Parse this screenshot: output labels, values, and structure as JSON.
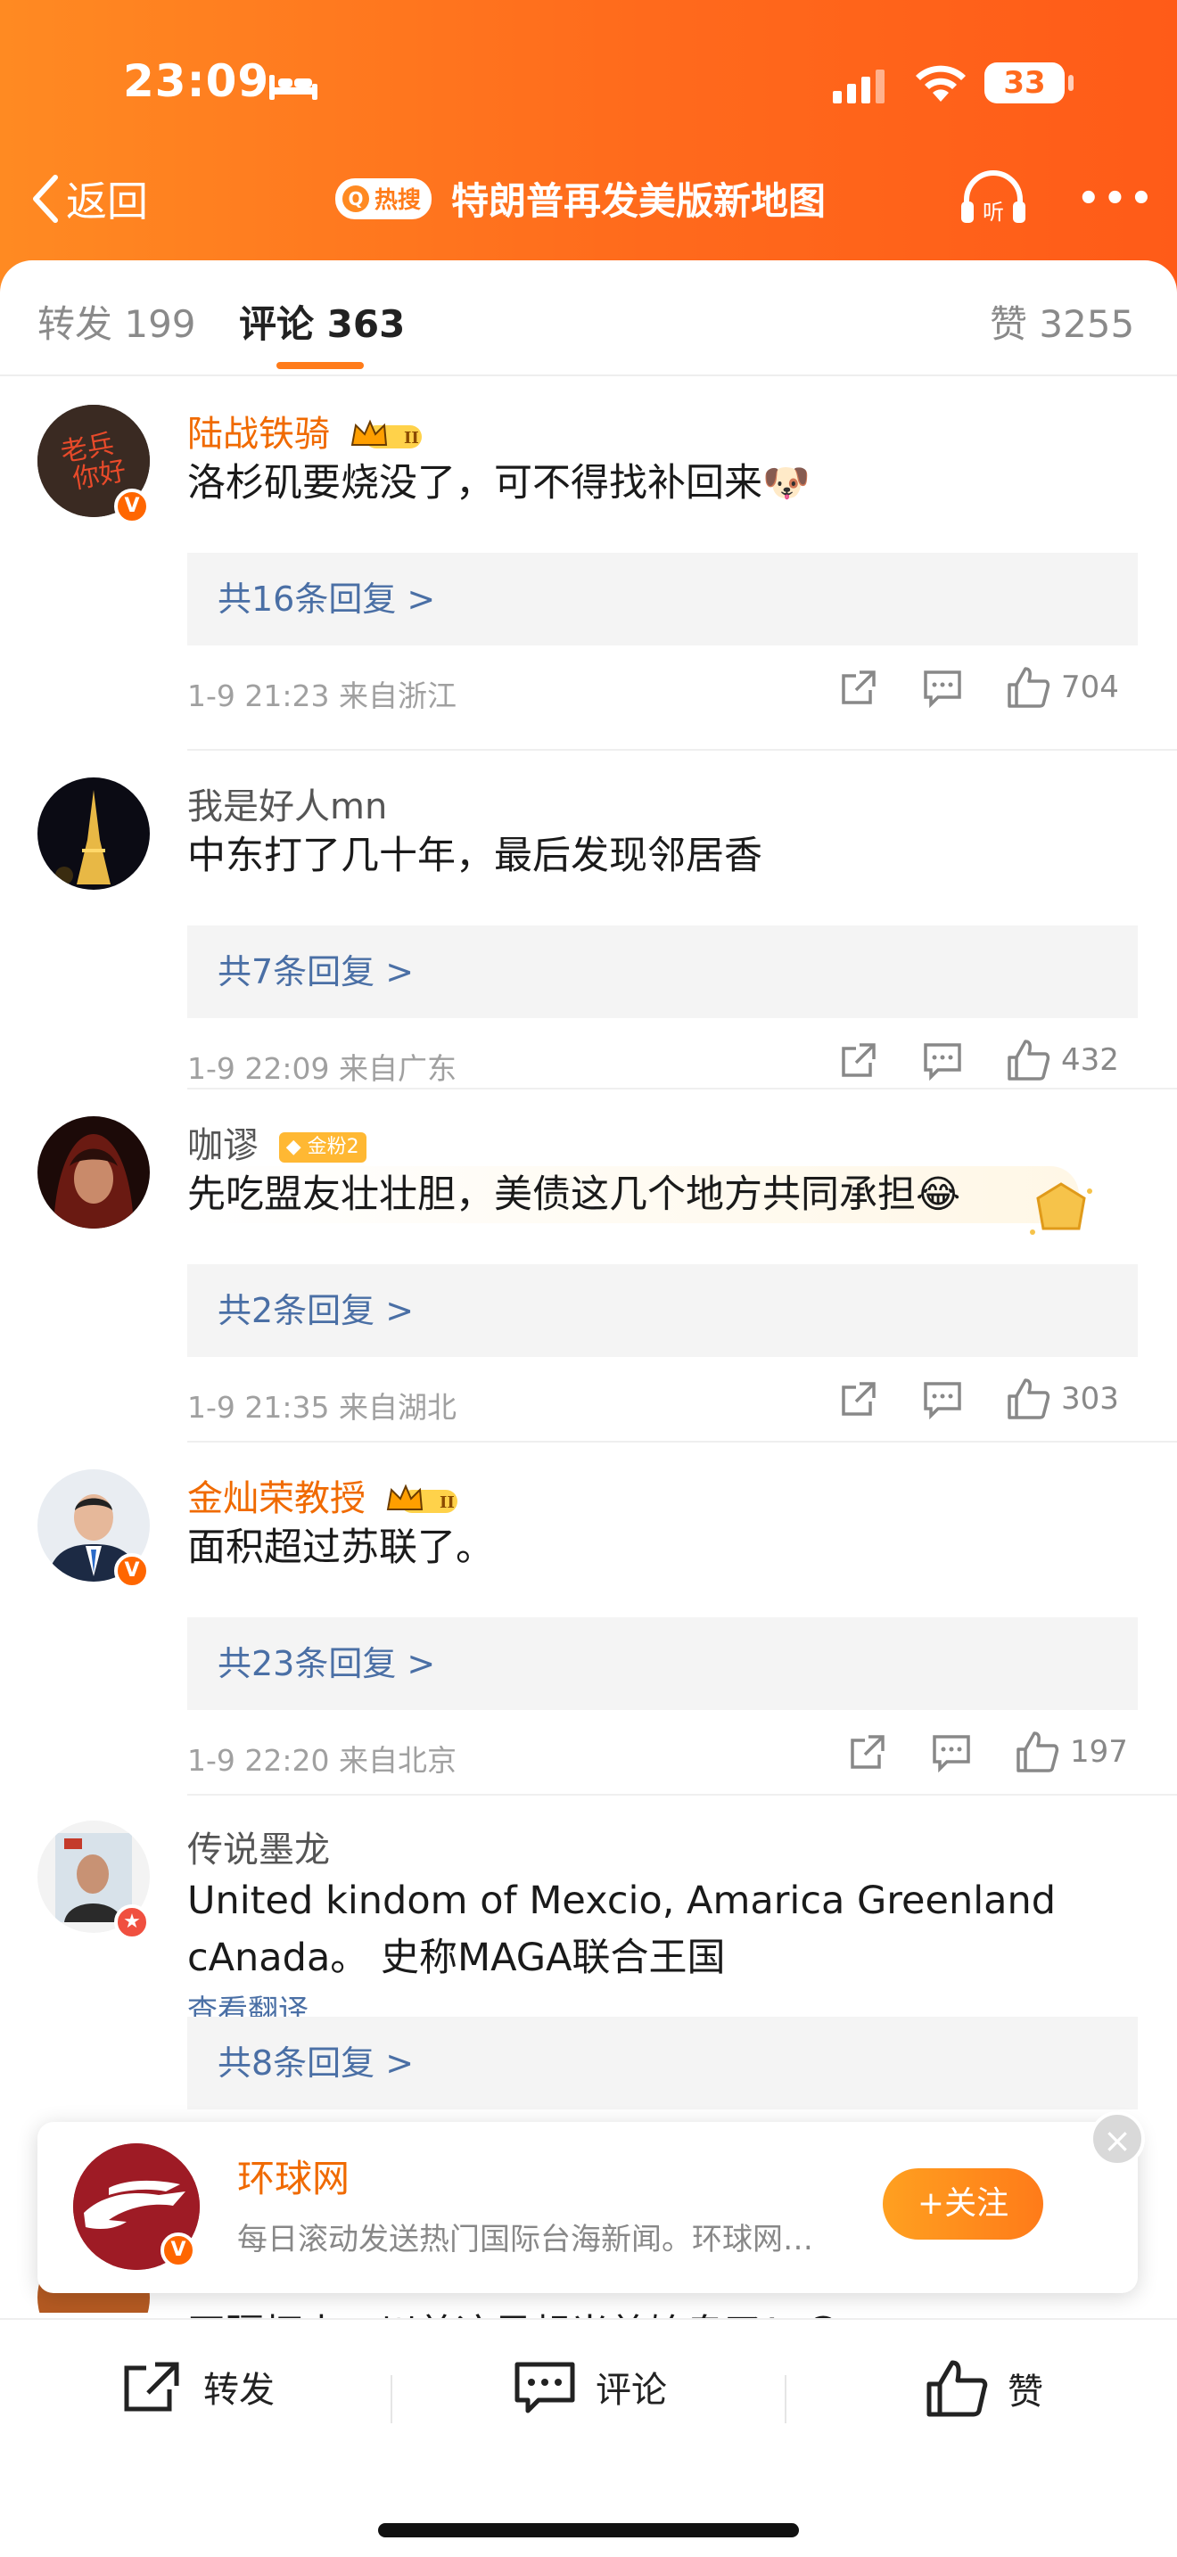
{
  "status_bar": {
    "time": "23:09",
    "battery": "33"
  },
  "navbar": {
    "back_label": "返回",
    "hot_badge": "热搜",
    "title": "特朗普再发美版新地图",
    "listen_label": "听"
  },
  "tabs": {
    "repost": "转发 199",
    "comments": "评论 363",
    "likes": "赞 3255"
  },
  "comments": [
    {
      "user": "陆战铁骑",
      "vip": true,
      "text": "洛杉矶要烧没了，可不得找补回来🐶",
      "replies": "共16条回复 >",
      "meta": "1-9 21:23  来自浙江",
      "likes": "704"
    },
    {
      "user": "我是好人mn",
      "vip": false,
      "text": "中东打了几十年，最后发现邻居香",
      "replies": "共7条回复 >",
      "meta": "1-9 22:09  来自广东",
      "likes": "432"
    },
    {
      "user": "咖谬",
      "badge": "金粉2",
      "vip": false,
      "text": "先吃盟友壮壮胆，美债这几个地方共同承担😂",
      "replies": "共2条回复 >",
      "meta": "1-9 21:35  来自湖北",
      "likes": "303"
    },
    {
      "user": "金灿荣教授",
      "vip": true,
      "text": "面积超过苏联了。",
      "replies": "共23条回复 >",
      "meta": "1-9 22:20  来自北京",
      "likes": "197"
    },
    {
      "user": "传说墨龙",
      "vip": false,
      "text": "United kindom of Mexcio, Amarica Greenland cAnada。 史称MAGA联合王国",
      "translate": "查看翻译",
      "replies": "共8条回复 >"
    }
  ],
  "partial_comment": {
    "text": "开疆拓土，川普这是想当美始皇了！😂"
  },
  "follow_card": {
    "name": "环球网",
    "desc": "每日滚动发送热门国际台海新闻。环球网…",
    "follow": "+关注"
  },
  "bottom_bar": {
    "repost": "转发",
    "comment": "评论",
    "like": "赞"
  },
  "colors": {
    "accent": "#ff7b19",
    "vip_name": "#f06a00",
    "link": "#4a6fa5"
  }
}
